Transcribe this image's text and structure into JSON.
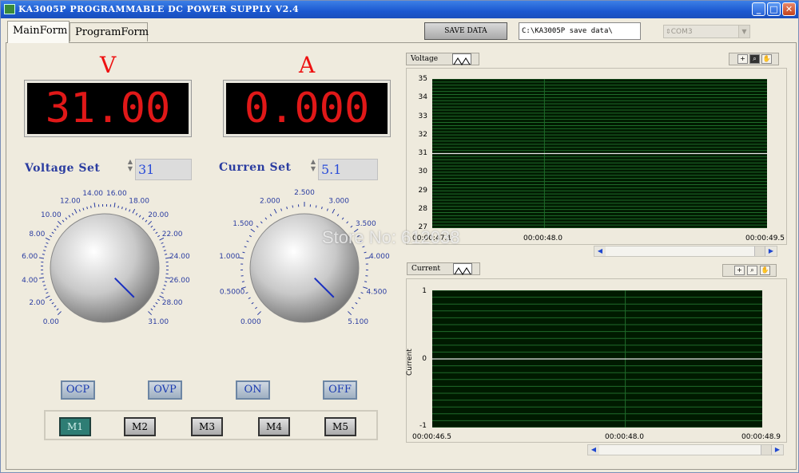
{
  "window": {
    "title": "KA3005P PROGRAMMABLE DC POWER SUPPLY V2.4",
    "minimize": "_",
    "maximize": "□",
    "close": "✕"
  },
  "tabs": [
    {
      "label": "MainForm",
      "active": true
    },
    {
      "label": "ProgramForm",
      "active": false
    }
  ],
  "toolbar": {
    "save_label": "SAVE DATA",
    "save_path": "C:\\KA3005P save data\\",
    "port": "COM3"
  },
  "meters": {
    "voltage_unit": "V",
    "current_unit": "A",
    "voltage_reading": "31.00",
    "current_reading": "0.000"
  },
  "settings": {
    "voltage_label": "Voltage Set",
    "voltage_value": "31",
    "current_label": "Curren Set",
    "current_value": "5.1"
  },
  "voltage_knob": {
    "ticks": [
      "0.00",
      "2.00",
      "4.00",
      "6.00",
      "8.00",
      "10.00",
      "12.00",
      "14.00",
      "16.00",
      "18.00",
      "20.00",
      "22.00",
      "24.00",
      "26.00",
      "28.00",
      "31.00"
    ],
    "value": 31
  },
  "current_knob": {
    "ticks": [
      "0.000",
      "0.5000",
      "1.000",
      "1.500",
      "2.000",
      "2.500",
      "3.000",
      "3.500",
      "4.000",
      "4.500",
      "5.100"
    ],
    "value": 5.1
  },
  "buttons": {
    "ocp": "OCP",
    "ovp": "OVP",
    "on": "ON",
    "off": "OFF"
  },
  "memory": {
    "items": [
      "M1",
      "M2",
      "M3",
      "M4",
      "M5"
    ],
    "active": "M1"
  },
  "voltage_graph": {
    "label": "Voltage",
    "y_ticks": [
      "35",
      "34",
      "33",
      "32",
      "31",
      "30",
      "29",
      "28",
      "27"
    ],
    "x_ticks": [
      "00:00:47.1",
      "00:00:48.0",
      "00:00:49.5"
    ]
  },
  "current_graph": {
    "label": "Current",
    "ylabel": "Current",
    "y_ticks": [
      "1",
      "0",
      "-1"
    ],
    "x_ticks": [
      "00:00:46.5",
      "00:00:48.0",
      "00:00:48.9"
    ]
  },
  "chart_data": [
    {
      "type": "line",
      "title": "",
      "xlabel": "",
      "ylabel": "",
      "ylim": [
        27,
        35
      ],
      "x": [
        "00:00:47.1",
        "00:00:48.0",
        "00:00:49.5"
      ],
      "series": [
        {
          "values": [
            31,
            31,
            31
          ]
        }
      ],
      "grid": true
    },
    {
      "type": "line",
      "title": "",
      "xlabel": "",
      "ylabel": "Current",
      "ylim": [
        -1,
        1
      ],
      "x": [
        "00:00:46.5",
        "00:00:48.0",
        "00:00:48.9"
      ],
      "series": [
        {
          "values": [
            0,
            0,
            0
          ]
        }
      ],
      "grid": true
    }
  ],
  "watermark": "Store No: 612038",
  "colors": {
    "display_text": "#e01818",
    "label_blue": "#2a3ca0",
    "plot_bg": "#001a00",
    "grid": "#1f6b2a",
    "trace": "#e8e8e8",
    "active_memory": "#2e7d74"
  }
}
